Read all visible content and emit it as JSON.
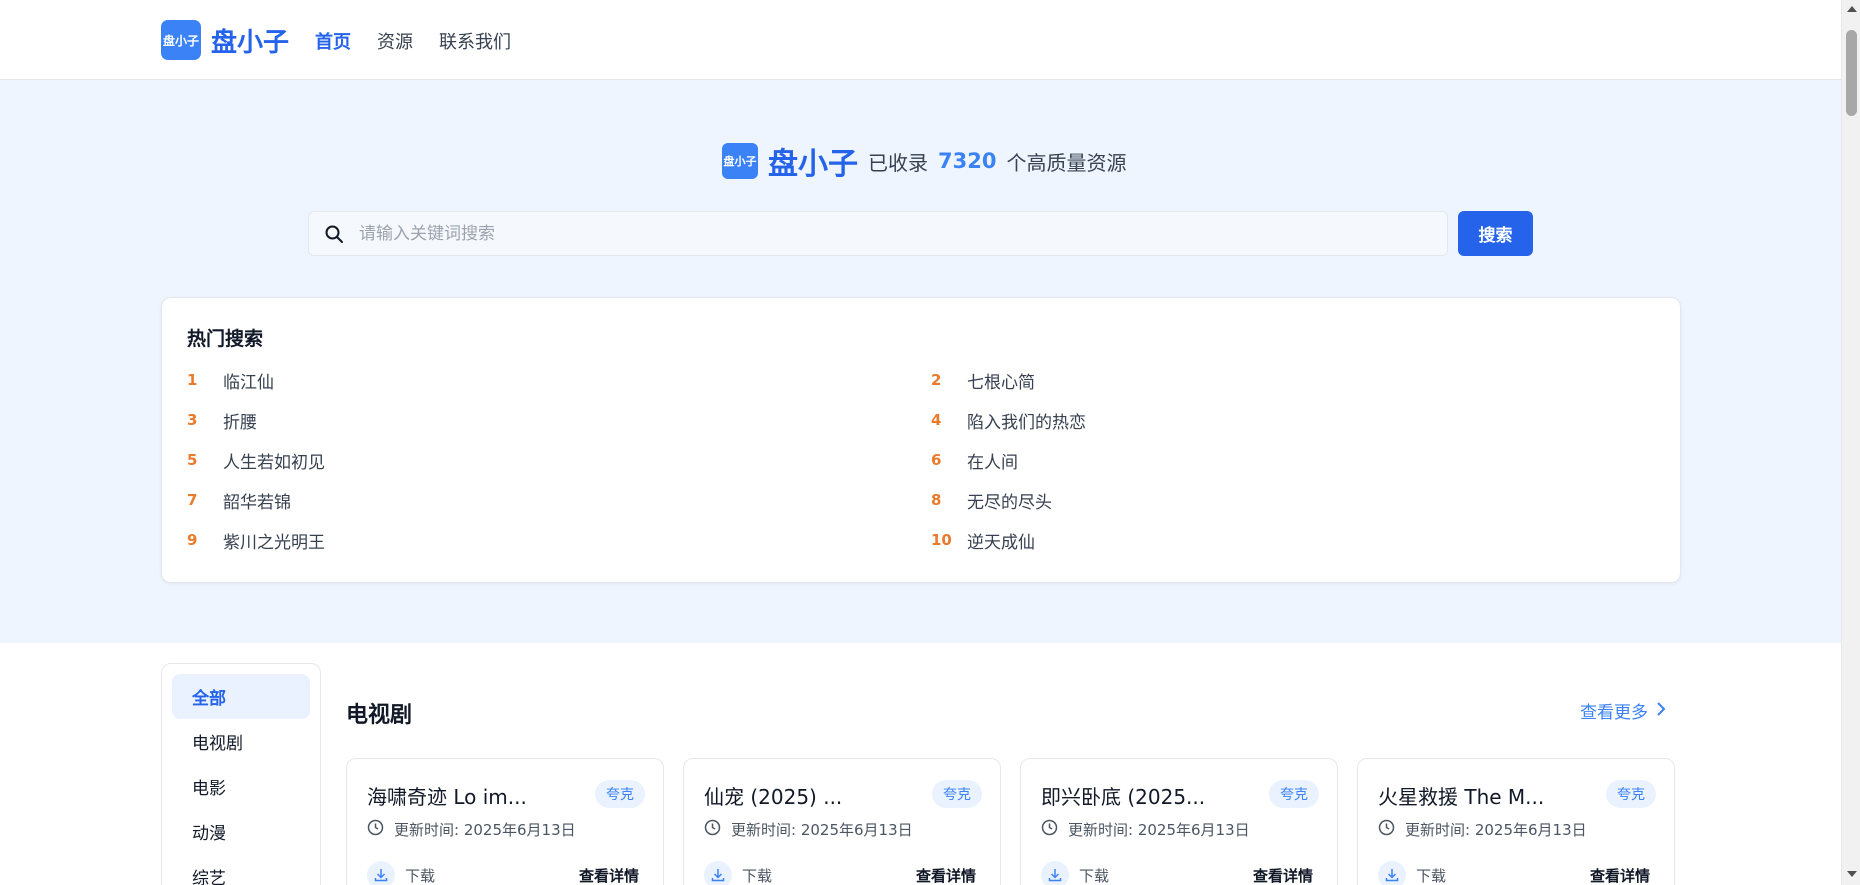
{
  "header": {
    "logo_text": "盘小子",
    "brand": "盘小子",
    "nav": [
      {
        "label": "首页",
        "active": true
      },
      {
        "label": "资源",
        "active": false
      },
      {
        "label": "联系我们",
        "active": false
      }
    ]
  },
  "hero": {
    "logo_text": "盘小子",
    "brand": "盘小子",
    "prefix": "已收录",
    "count": "7320",
    "suffix": "个高质量资源",
    "search_placeholder": "请输入关键词搜索",
    "search_button": "搜索"
  },
  "hot": {
    "title": "热门搜索",
    "items": [
      {
        "rank": "1",
        "name": "临江仙"
      },
      {
        "rank": "2",
        "name": "七根心简"
      },
      {
        "rank": "3",
        "name": "折腰"
      },
      {
        "rank": "4",
        "name": "陷入我们的热恋"
      },
      {
        "rank": "5",
        "name": "人生若如初见"
      },
      {
        "rank": "6",
        "name": "在人间"
      },
      {
        "rank": "7",
        "name": "韶华若锦"
      },
      {
        "rank": "8",
        "name": "无尽的尽头"
      },
      {
        "rank": "9",
        "name": "紫川之光明王"
      },
      {
        "rank": "10",
        "name": "逆天成仙"
      }
    ]
  },
  "sidebar": {
    "items": [
      {
        "label": "全部",
        "active": true
      },
      {
        "label": "电视剧",
        "active": false
      },
      {
        "label": "电影",
        "active": false
      },
      {
        "label": "动漫",
        "active": false
      },
      {
        "label": "综艺",
        "active": false
      }
    ]
  },
  "section": {
    "title": "电视剧",
    "more": "查看更多"
  },
  "cards": [
    {
      "title": "海啸奇迹 Lo im...",
      "tag": "夸克",
      "time": "更新时间: 2025年6月13日",
      "download": "下载",
      "detail": "查看详情"
    },
    {
      "title": "仙宠 (2025) ...",
      "tag": "夸克",
      "time": "更新时间: 2025年6月13日",
      "download": "下载",
      "detail": "查看详情"
    },
    {
      "title": "即兴卧底 (2025...",
      "tag": "夸克",
      "time": "更新时间: 2025年6月13日",
      "download": "下载",
      "detail": "查看详情"
    },
    {
      "title": "火星救援 The M...",
      "tag": "夸克",
      "time": "更新时间: 2025年6月13日",
      "download": "下载",
      "detail": "查看详情"
    }
  ],
  "icons": {
    "search": "search-icon",
    "clock": "clock-icon",
    "download": "download-icon",
    "chevron": "chevron-right-icon"
  },
  "colors": {
    "primary": "#2563eb",
    "hero_bg": "#eef5ff",
    "rank": "#ea7a2c"
  }
}
